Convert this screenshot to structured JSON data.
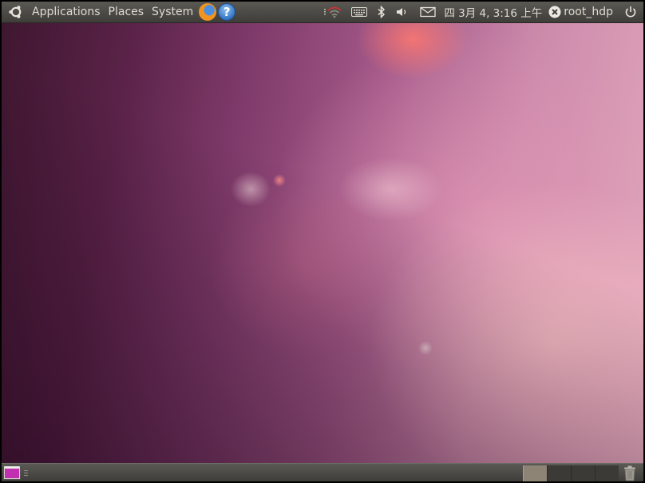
{
  "top_panel": {
    "menus": {
      "applications": "Applications",
      "places": "Places",
      "system": "System"
    },
    "launchers": {
      "firefox": "firefox-icon",
      "help": "?"
    },
    "tray": {
      "icons": [
        "network-wireless-icon",
        "keyboard-icon",
        "bluetooth-icon",
        "volume-icon",
        "mail-icon"
      ]
    },
    "clock": "四 3月 4, 3:16 上午",
    "user": {
      "name": "root_hdp",
      "status_icon": "status-offline-icon"
    },
    "power_icon": "power-icon"
  },
  "bottom_panel": {
    "show_desktop_icon": "show-desktop-icon",
    "workspaces": [
      {
        "active": true
      },
      {
        "active": false
      },
      {
        "active": false
      },
      {
        "active": false
      }
    ],
    "trash_icon": "trash-icon"
  },
  "colors": {
    "panel": "#4a4945",
    "panel_text": "#dfdbd2",
    "wallpaper_accent": "#a55a8a"
  }
}
